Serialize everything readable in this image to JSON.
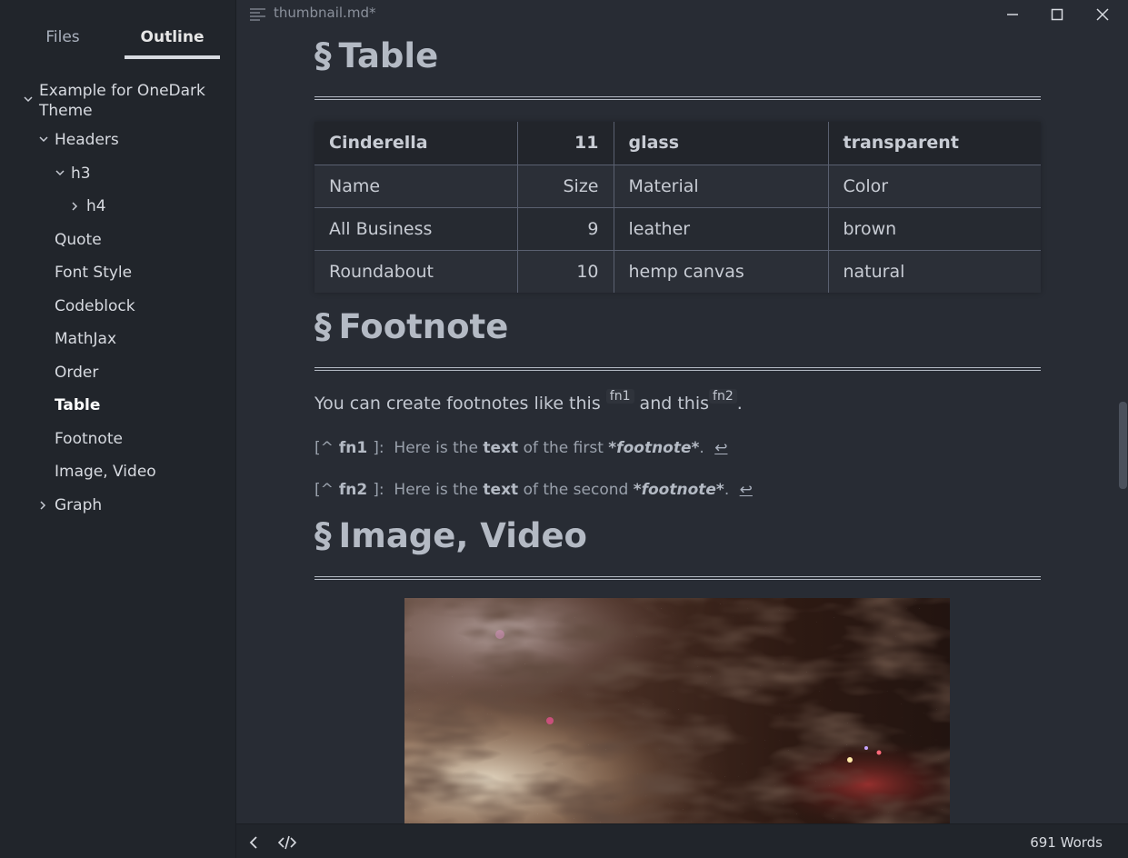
{
  "sidebar": {
    "tabs": [
      {
        "label": "Files"
      },
      {
        "label": "Outline"
      }
    ],
    "outline": [
      {
        "label": "Example for OneDark Theme",
        "line1": "Example for OneDark",
        "line2": "Theme"
      },
      {
        "label": "Headers"
      },
      {
        "label": "h3"
      },
      {
        "label": "h4"
      },
      {
        "label": "Quote"
      },
      {
        "label": "Font Style"
      },
      {
        "label": "Codeblock"
      },
      {
        "label": "MathJax"
      },
      {
        "label": "Order"
      },
      {
        "label": "Table"
      },
      {
        "label": "Footnote"
      },
      {
        "label": "Image, Video"
      },
      {
        "label": "Graph"
      }
    ]
  },
  "titlebar": {
    "filename": "thumbnail.md",
    "modified": "*"
  },
  "content": {
    "section_symbol": "§",
    "sections": [
      {
        "title": "Table"
      },
      {
        "title": "Footnote"
      },
      {
        "title": "Image, Video"
      }
    ],
    "table": {
      "header": [
        "Cinderella",
        "11",
        "glass",
        "transparent"
      ],
      "rows": [
        [
          "Name",
          "Size",
          "Material",
          "Color"
        ],
        [
          "All Business",
          "9",
          "leather",
          "brown"
        ],
        [
          "Roundabout",
          "10",
          "hemp canvas",
          "natural"
        ]
      ]
    },
    "footnote_para": {
      "part1": "You can create footnotes like this",
      "ref1": "fn1",
      "part2": "and this",
      "ref2": "fn2",
      "end": "."
    },
    "footnotes": [
      {
        "open": "[^",
        "id": "fn1",
        "close": "]:",
        "t1": "Here is the",
        "bold": "text",
        "t2": "of the first",
        "em": "*footnote*",
        "end": ".",
        "back": "↩"
      },
      {
        "open": "[^",
        "id": "fn2",
        "close": "]:",
        "t1": "Here is the",
        "bold": "text",
        "t2": "of the second",
        "em": "*footnote*",
        "end": ".",
        "back": "↩"
      }
    ]
  },
  "footer": {
    "word_count": "691 Words"
  },
  "colors": {
    "background": "#282c34",
    "sidebar": "#21252b",
    "text": "#abb2bf"
  }
}
